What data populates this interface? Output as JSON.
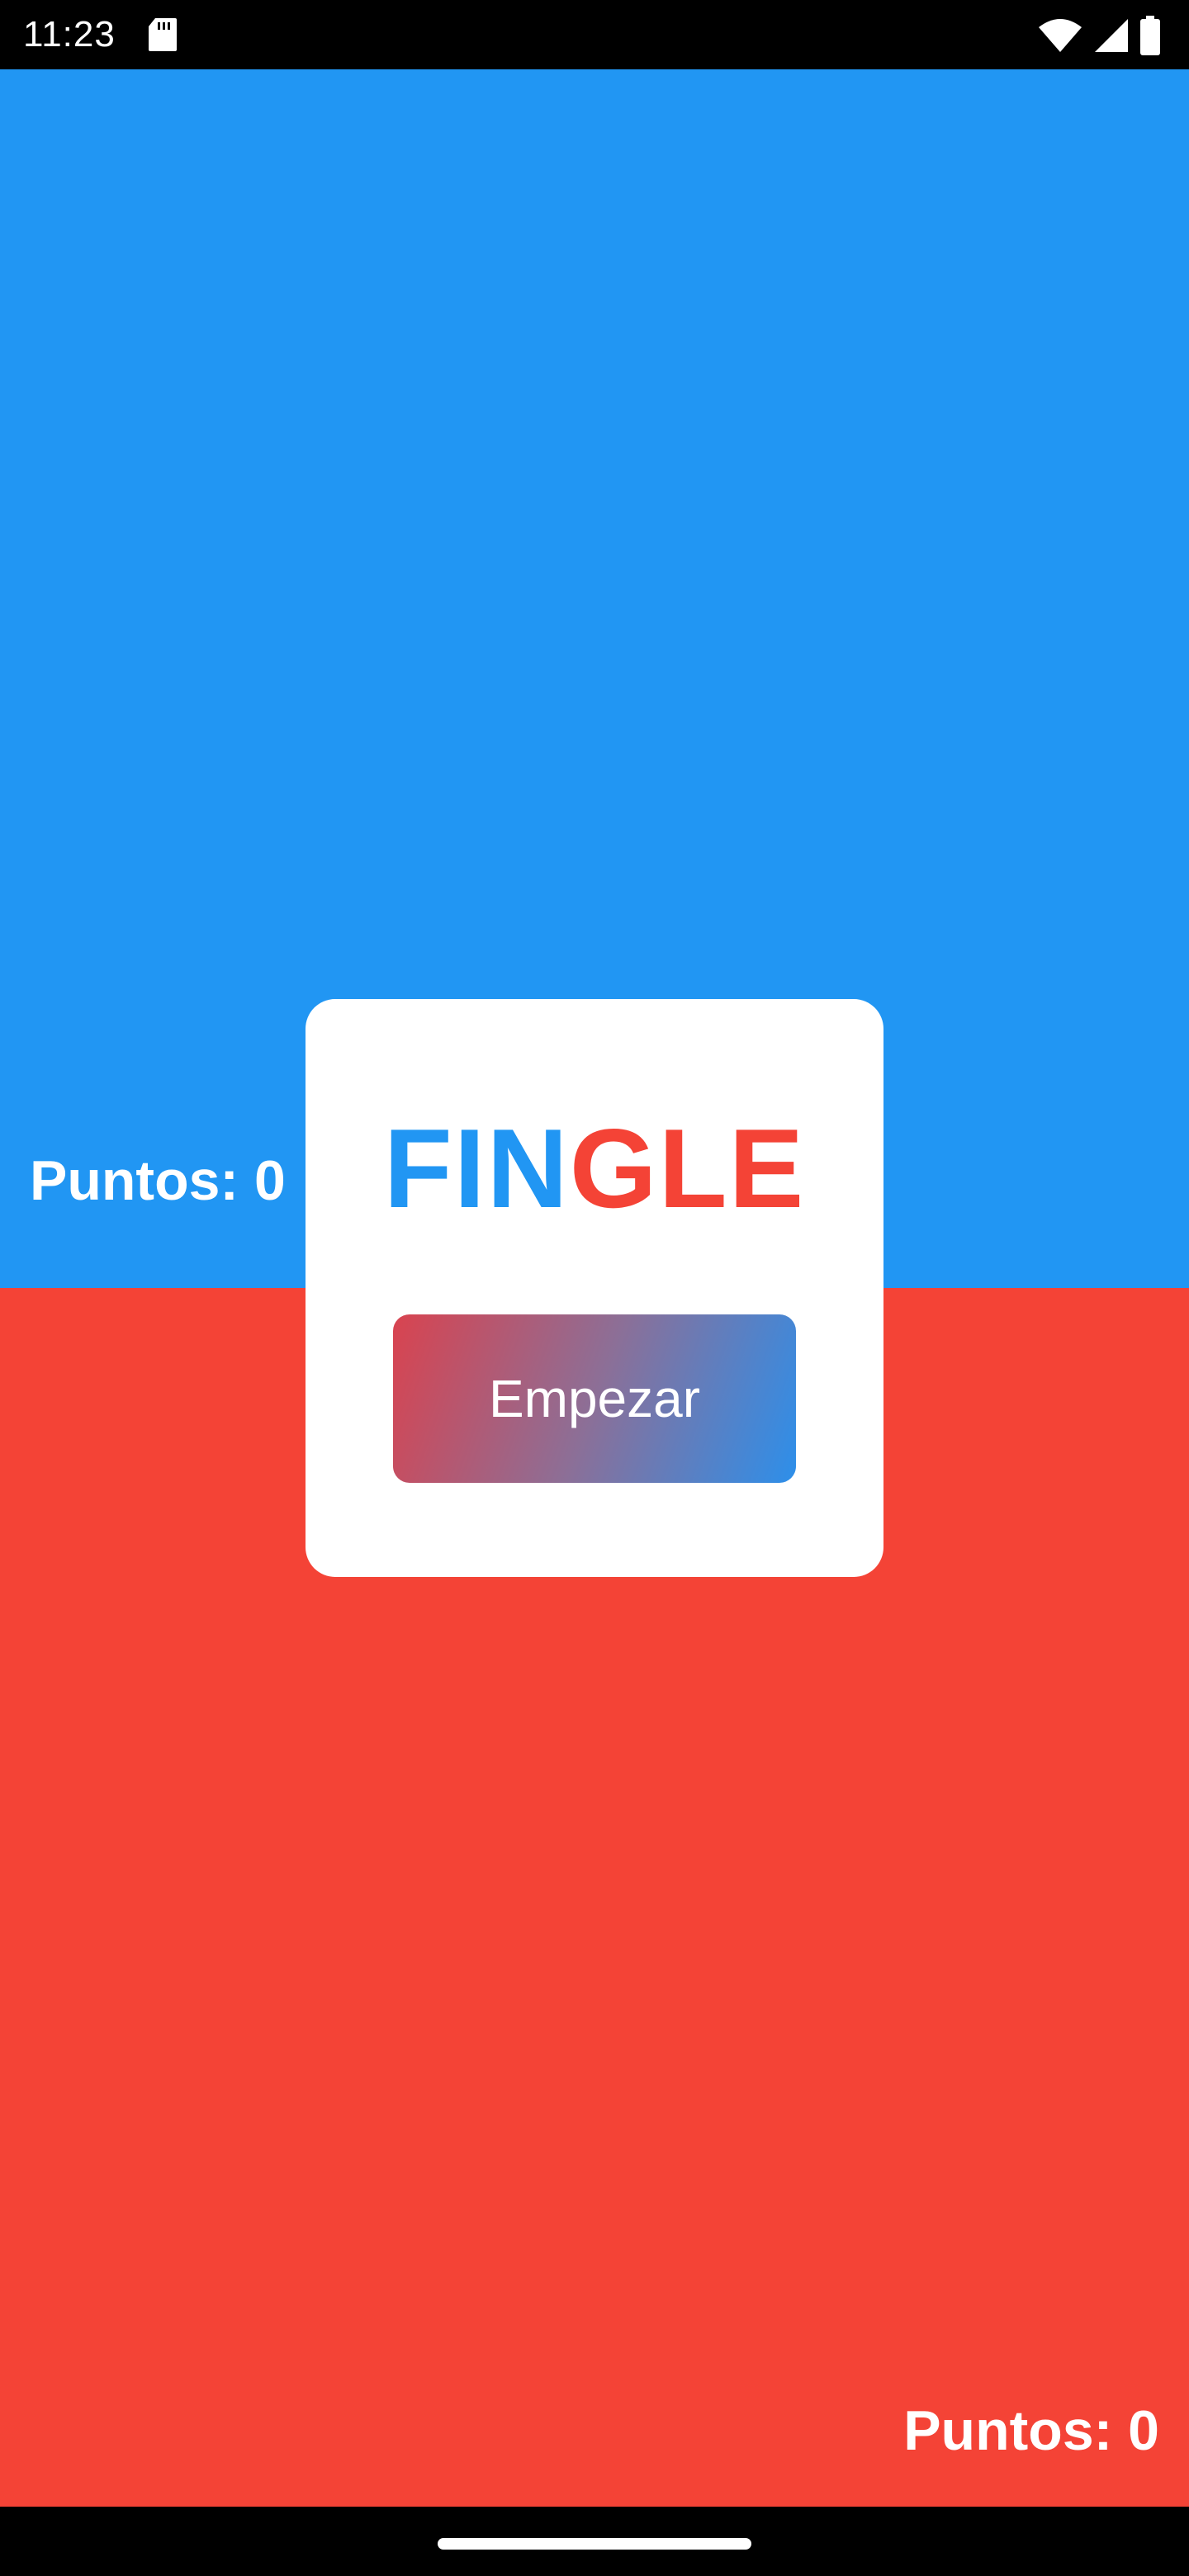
{
  "status_bar": {
    "time": "11:23",
    "icons": [
      "sd-card-icon",
      "wifi-icon",
      "signal-icon",
      "battery-icon"
    ]
  },
  "game": {
    "top_player": {
      "score_label": "Puntos: 0",
      "color": "#2196F3"
    },
    "bottom_player": {
      "score_label": "Puntos: 0",
      "color": "#F44336"
    }
  },
  "dialog": {
    "title_part1": "FIN",
    "title_part2": "GLE",
    "start_button_label": "Empezar"
  },
  "colors": {
    "blue": "#2196F3",
    "red": "#F44336",
    "button_gradient_start": "#D9434F",
    "button_gradient_end": "#2D8FEA"
  }
}
